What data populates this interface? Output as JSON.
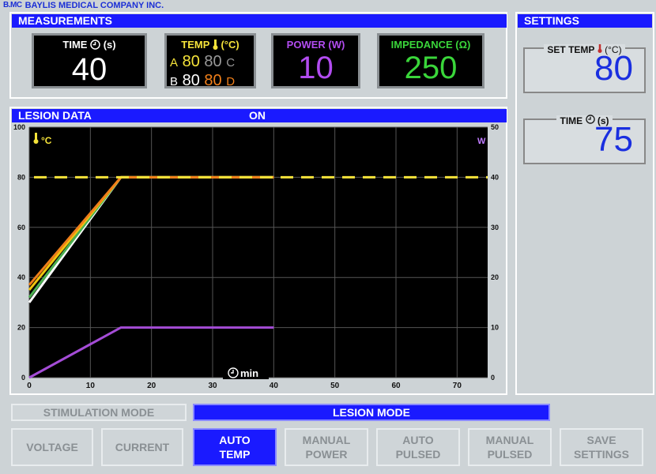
{
  "brand": {
    "logo": "B.MC",
    "company": "BAYLIS MEDICAL COMPANY INC."
  },
  "measurements": {
    "title": "MEASUREMENTS",
    "time": {
      "label": "TIME",
      "unit": "(s)",
      "value": "40"
    },
    "temp": {
      "label": "TEMP",
      "unit": "(°C)",
      "a_label": "A",
      "a1": "80",
      "a2": "80",
      "c_label": "C",
      "b_label": "B",
      "b1": "80",
      "b2": "80",
      "d_label": "D"
    },
    "power": {
      "label": "POWER (W)",
      "value": "10"
    },
    "impedance": {
      "label": "IMPEDANCE (Ω)",
      "value": "250"
    }
  },
  "settings": {
    "title": "SETTINGS",
    "set_temp": {
      "label": "SET TEMP",
      "unit": "(°C)",
      "value": "80"
    },
    "time": {
      "label": "TIME",
      "unit": "(s)",
      "value": "75"
    }
  },
  "lesion": {
    "title": "LESION DATA",
    "status": "ON"
  },
  "chart_data": {
    "type": "line",
    "left_axis_label": "°C",
    "right_axis_label": "W",
    "x_label": "min",
    "x_ticks": [
      0,
      10,
      20,
      30,
      40,
      50,
      60,
      70
    ],
    "xlim": [
      0,
      75
    ],
    "y_left_ticks": [
      0,
      20,
      40,
      60,
      80,
      100
    ],
    "ylim_left": [
      0,
      100
    ],
    "y_right_ticks": [
      0,
      10,
      20,
      30,
      40,
      50
    ],
    "ylim_right": [
      0,
      50
    ],
    "grid": true,
    "setpoint": {
      "value": 80,
      "color": "#f5e33a"
    },
    "series": [
      {
        "color": "#ffffff",
        "axis": "left",
        "x": [
          0,
          15,
          40
        ],
        "y": [
          30,
          80,
          80
        ]
      },
      {
        "color": "#4caf50",
        "axis": "left",
        "x": [
          0,
          15,
          40
        ],
        "y": [
          32,
          80,
          80
        ]
      },
      {
        "color": "#f1c40f",
        "axis": "left",
        "x": [
          0,
          15,
          40
        ],
        "y": [
          35,
          80,
          80
        ]
      },
      {
        "color": "#f07f1a",
        "axis": "left",
        "x": [
          0,
          15,
          40
        ],
        "y": [
          37,
          80,
          80
        ]
      },
      {
        "color": "#a44cd6",
        "axis": "right",
        "x": [
          0,
          15,
          40
        ],
        "y": [
          0,
          10,
          10
        ]
      }
    ]
  },
  "modes": {
    "stimulation": "STIMULATION MODE",
    "lesion": "LESION MODE"
  },
  "buttons": [
    {
      "line1": "VOLTAGE",
      "line2": ""
    },
    {
      "line1": "CURRENT",
      "line2": ""
    },
    {
      "line1": "AUTO",
      "line2": "TEMP"
    },
    {
      "line1": "MANUAL",
      "line2": "POWER"
    },
    {
      "line1": "AUTO",
      "line2": "PULSED"
    },
    {
      "line1": "MANUAL",
      "line2": "PULSED"
    },
    {
      "line1": "SAVE",
      "line2": "SETTINGS"
    }
  ],
  "colors": {
    "accent": "#1a1aff",
    "value_blue": "#1a2fe0",
    "temp_label": "#f5e33a",
    "power": "#b24cf0",
    "impedance": "#3ad63a"
  }
}
